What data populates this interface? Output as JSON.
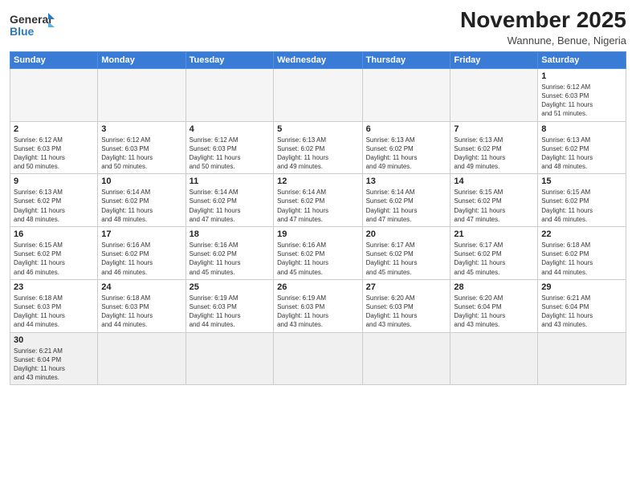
{
  "header": {
    "logo_general": "General",
    "logo_blue": "Blue",
    "month_title": "November 2025",
    "location": "Wannune, Benue, Nigeria"
  },
  "days_of_week": [
    "Sunday",
    "Monday",
    "Tuesday",
    "Wednesday",
    "Thursday",
    "Friday",
    "Saturday"
  ],
  "weeks": [
    [
      {
        "num": "",
        "info": ""
      },
      {
        "num": "",
        "info": ""
      },
      {
        "num": "",
        "info": ""
      },
      {
        "num": "",
        "info": ""
      },
      {
        "num": "",
        "info": ""
      },
      {
        "num": "",
        "info": ""
      },
      {
        "num": "1",
        "info": "Sunrise: 6:12 AM\nSunset: 6:03 PM\nDaylight: 11 hours\nand 51 minutes."
      }
    ],
    [
      {
        "num": "2",
        "info": "Sunrise: 6:12 AM\nSunset: 6:03 PM\nDaylight: 11 hours\nand 50 minutes."
      },
      {
        "num": "3",
        "info": "Sunrise: 6:12 AM\nSunset: 6:03 PM\nDaylight: 11 hours\nand 50 minutes."
      },
      {
        "num": "4",
        "info": "Sunrise: 6:12 AM\nSunset: 6:03 PM\nDaylight: 11 hours\nand 50 minutes."
      },
      {
        "num": "5",
        "info": "Sunrise: 6:13 AM\nSunset: 6:02 PM\nDaylight: 11 hours\nand 49 minutes."
      },
      {
        "num": "6",
        "info": "Sunrise: 6:13 AM\nSunset: 6:02 PM\nDaylight: 11 hours\nand 49 minutes."
      },
      {
        "num": "7",
        "info": "Sunrise: 6:13 AM\nSunset: 6:02 PM\nDaylight: 11 hours\nand 49 minutes."
      },
      {
        "num": "8",
        "info": "Sunrise: 6:13 AM\nSunset: 6:02 PM\nDaylight: 11 hours\nand 48 minutes."
      }
    ],
    [
      {
        "num": "9",
        "info": "Sunrise: 6:13 AM\nSunset: 6:02 PM\nDaylight: 11 hours\nand 48 minutes."
      },
      {
        "num": "10",
        "info": "Sunrise: 6:14 AM\nSunset: 6:02 PM\nDaylight: 11 hours\nand 48 minutes."
      },
      {
        "num": "11",
        "info": "Sunrise: 6:14 AM\nSunset: 6:02 PM\nDaylight: 11 hours\nand 47 minutes."
      },
      {
        "num": "12",
        "info": "Sunrise: 6:14 AM\nSunset: 6:02 PM\nDaylight: 11 hours\nand 47 minutes."
      },
      {
        "num": "13",
        "info": "Sunrise: 6:14 AM\nSunset: 6:02 PM\nDaylight: 11 hours\nand 47 minutes."
      },
      {
        "num": "14",
        "info": "Sunrise: 6:15 AM\nSunset: 6:02 PM\nDaylight: 11 hours\nand 47 minutes."
      },
      {
        "num": "15",
        "info": "Sunrise: 6:15 AM\nSunset: 6:02 PM\nDaylight: 11 hours\nand 46 minutes."
      }
    ],
    [
      {
        "num": "16",
        "info": "Sunrise: 6:15 AM\nSunset: 6:02 PM\nDaylight: 11 hours\nand 46 minutes."
      },
      {
        "num": "17",
        "info": "Sunrise: 6:16 AM\nSunset: 6:02 PM\nDaylight: 11 hours\nand 46 minutes."
      },
      {
        "num": "18",
        "info": "Sunrise: 6:16 AM\nSunset: 6:02 PM\nDaylight: 11 hours\nand 45 minutes."
      },
      {
        "num": "19",
        "info": "Sunrise: 6:16 AM\nSunset: 6:02 PM\nDaylight: 11 hours\nand 45 minutes."
      },
      {
        "num": "20",
        "info": "Sunrise: 6:17 AM\nSunset: 6:02 PM\nDaylight: 11 hours\nand 45 minutes."
      },
      {
        "num": "21",
        "info": "Sunrise: 6:17 AM\nSunset: 6:02 PM\nDaylight: 11 hours\nand 45 minutes."
      },
      {
        "num": "22",
        "info": "Sunrise: 6:18 AM\nSunset: 6:02 PM\nDaylight: 11 hours\nand 44 minutes."
      }
    ],
    [
      {
        "num": "23",
        "info": "Sunrise: 6:18 AM\nSunset: 6:03 PM\nDaylight: 11 hours\nand 44 minutes."
      },
      {
        "num": "24",
        "info": "Sunrise: 6:18 AM\nSunset: 6:03 PM\nDaylight: 11 hours\nand 44 minutes."
      },
      {
        "num": "25",
        "info": "Sunrise: 6:19 AM\nSunset: 6:03 PM\nDaylight: 11 hours\nand 44 minutes."
      },
      {
        "num": "26",
        "info": "Sunrise: 6:19 AM\nSunset: 6:03 PM\nDaylight: 11 hours\nand 43 minutes."
      },
      {
        "num": "27",
        "info": "Sunrise: 6:20 AM\nSunset: 6:03 PM\nDaylight: 11 hours\nand 43 minutes."
      },
      {
        "num": "28",
        "info": "Sunrise: 6:20 AM\nSunset: 6:04 PM\nDaylight: 11 hours\nand 43 minutes."
      },
      {
        "num": "29",
        "info": "Sunrise: 6:21 AM\nSunset: 6:04 PM\nDaylight: 11 hours\nand 43 minutes."
      }
    ],
    [
      {
        "num": "30",
        "info": "Sunrise: 6:21 AM\nSunset: 6:04 PM\nDaylight: 11 hours\nand 43 minutes."
      },
      {
        "num": "",
        "info": ""
      },
      {
        "num": "",
        "info": ""
      },
      {
        "num": "",
        "info": ""
      },
      {
        "num": "",
        "info": ""
      },
      {
        "num": "",
        "info": ""
      },
      {
        "num": "",
        "info": ""
      }
    ]
  ]
}
